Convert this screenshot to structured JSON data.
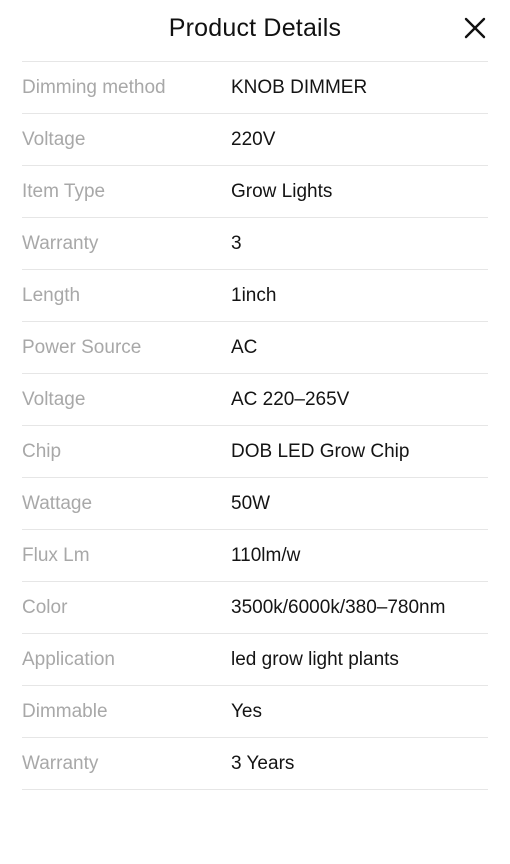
{
  "header": {
    "title": "Product Details",
    "close_icon": "close-icon"
  },
  "details": [
    {
      "label": "Dimming method",
      "value": "KNOB DIMMER"
    },
    {
      "label": "Voltage",
      "value": "220V"
    },
    {
      "label": "Item Type",
      "value": "Grow Lights"
    },
    {
      "label": "Warranty",
      "value": "3"
    },
    {
      "label": "Length",
      "value": "1inch"
    },
    {
      "label": "Power Source",
      "value": "AC"
    },
    {
      "label": "Voltage",
      "value": "AC 220–265V"
    },
    {
      "label": "Chip",
      "value": "DOB LED Grow Chip"
    },
    {
      "label": "Wattage",
      "value": "50W"
    },
    {
      "label": "Flux Lm",
      "value": "110lm/w"
    },
    {
      "label": "Color",
      "value": "3500k/6000k/380–780nm"
    },
    {
      "label": "Application",
      "value": "led grow light plants"
    },
    {
      "label": "Dimmable",
      "value": "Yes"
    },
    {
      "label": "Warranty",
      "value": "3 Years"
    }
  ],
  "colors": {
    "label_text": "#a8a8a8",
    "value_text": "#141414",
    "divider": "#e6e6e6"
  }
}
